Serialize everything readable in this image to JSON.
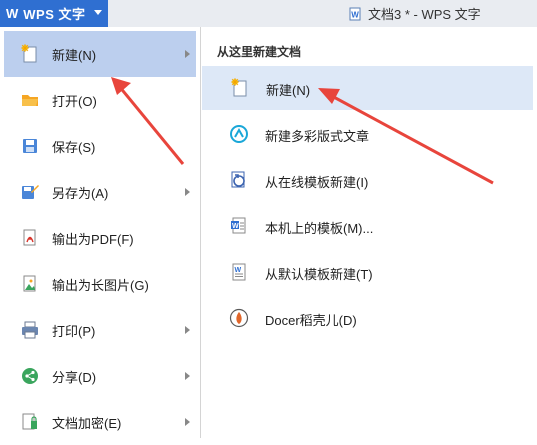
{
  "titlebar": {
    "app_logo": "W",
    "app_name": "WPS 文字",
    "doc_title": "文档3 * - WPS 文字"
  },
  "menu": {
    "items": [
      {
        "label": "新建(N)",
        "icon": "new-doc-icon",
        "has_submenu": true,
        "active": true
      },
      {
        "label": "打开(O)",
        "icon": "folder-icon",
        "has_submenu": false
      },
      {
        "label": "保存(S)",
        "icon": "save-icon",
        "has_submenu": false
      },
      {
        "label": "另存为(A)",
        "icon": "save-as-icon",
        "has_submenu": true
      },
      {
        "label": "输出为PDF(F)",
        "icon": "pdf-icon",
        "has_submenu": false
      },
      {
        "label": "输出为长图片(G)",
        "icon": "image-icon",
        "has_submenu": false
      },
      {
        "label": "打印(P)",
        "icon": "printer-icon",
        "has_submenu": true
      },
      {
        "label": "分享(D)",
        "icon": "share-icon",
        "has_submenu": true
      },
      {
        "label": "文档加密(E)",
        "icon": "lock-icon",
        "has_submenu": true
      }
    ]
  },
  "submenu": {
    "heading": "从这里新建文档",
    "items": [
      {
        "label": "新建(N)",
        "icon": "new-doc-icon",
        "active": true
      },
      {
        "label": "新建多彩版式文章",
        "icon": "colorful-article-icon"
      },
      {
        "label": "从在线模板新建(I)",
        "icon": "online-template-icon"
      },
      {
        "label": "本机上的模板(M)...",
        "icon": "local-template-icon"
      },
      {
        "label": "从默认模板新建(T)",
        "icon": "default-template-icon"
      },
      {
        "label": "Docer稻壳儿(D)",
        "icon": "docer-icon"
      }
    ]
  },
  "colors": {
    "brand_blue": "#2f6fd1",
    "menu_active": "#bccfee",
    "submenu_active": "#dde8f7",
    "annotation_arrow": "#e8453c"
  }
}
